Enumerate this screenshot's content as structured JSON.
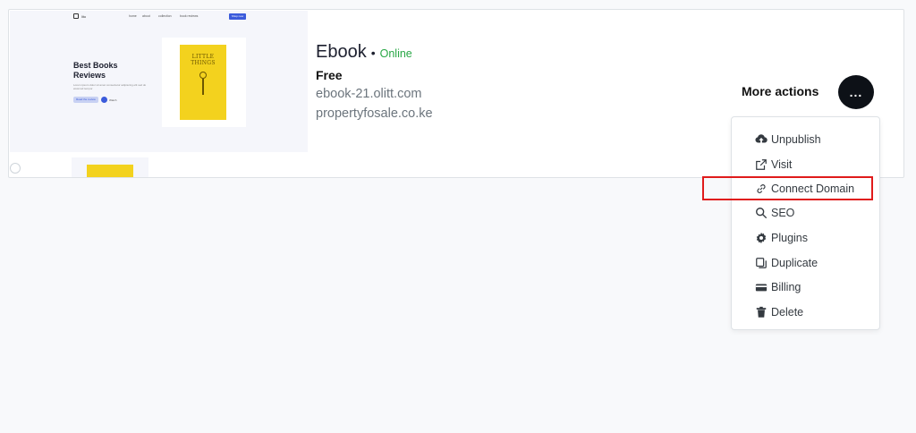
{
  "thumbnail": {
    "logo_text": "lito",
    "nav": [
      "home",
      "about",
      "collection",
      "book reviews"
    ],
    "cta_top": "Shop now",
    "title": "Best Books Reviews",
    "subtitle": "Lorem ipsum dolor sit amet consectetur adipiscing elit sed do eiusmod tempor",
    "cta_button": "Read the review",
    "play_label": "Watch",
    "book_title": "LITTLE THINGS"
  },
  "site": {
    "name": "Ebook",
    "bullet": "•",
    "status": "Online",
    "status_color": "#28a745",
    "plan": "Free",
    "domains": [
      "ebook-21.olitt.com",
      "propertyfosale.co.ke"
    ]
  },
  "actions": {
    "label": "More actions",
    "button_label": "...",
    "menu": [
      {
        "label": "Unpublish",
        "icon": "cloud-upload-icon"
      },
      {
        "label": "Visit",
        "icon": "external-link-icon"
      },
      {
        "label": "Connect Domain",
        "icon": "link-icon"
      },
      {
        "label": "SEO",
        "icon": "search-icon"
      },
      {
        "label": "Plugins",
        "icon": "gear-icon"
      },
      {
        "label": "Duplicate",
        "icon": "duplicate-icon"
      },
      {
        "label": "Billing",
        "icon": "billing-icon"
      },
      {
        "label": "Delete",
        "icon": "trash-icon"
      }
    ]
  },
  "highlight_color": "#e01b1b"
}
